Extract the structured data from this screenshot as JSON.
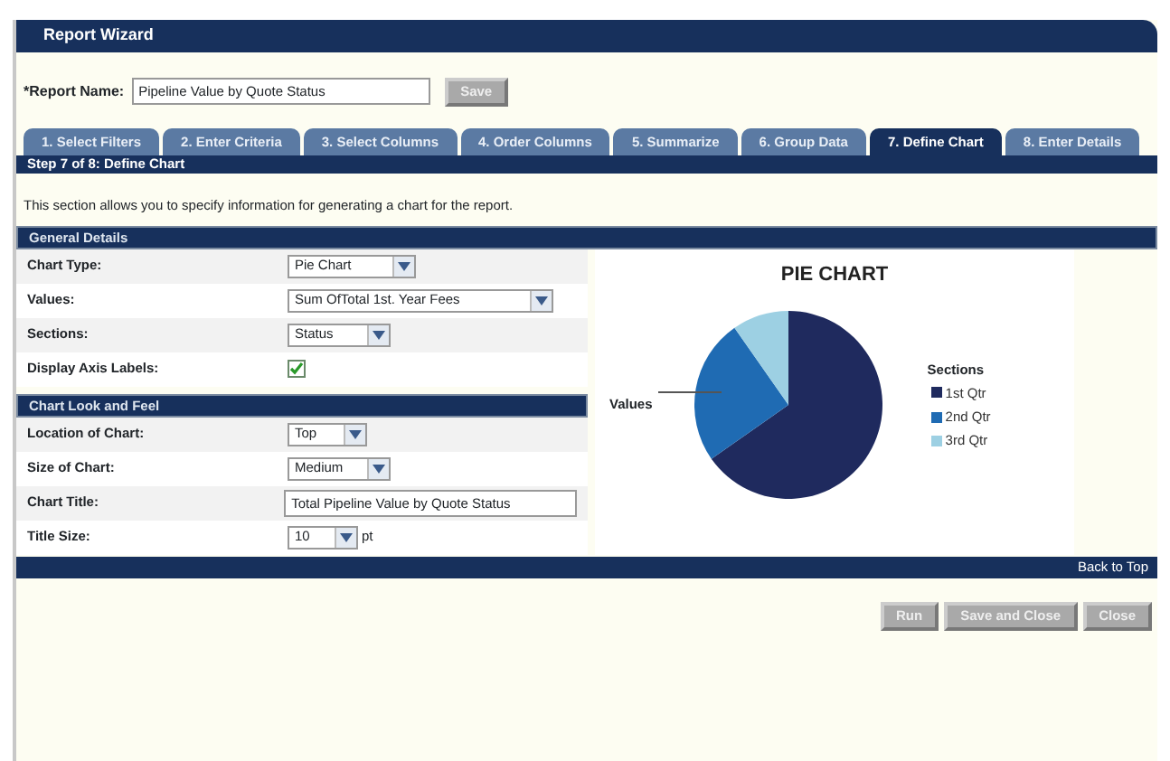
{
  "window": {
    "title": "Report Wizard"
  },
  "report_name": {
    "label": "*Report Name:",
    "value": "Pipeline Value by Quote Status"
  },
  "save_button": "Save",
  "tabs": [
    {
      "label": "1. Select Filters",
      "selected": false
    },
    {
      "label": "2. Enter Criteria",
      "selected": false
    },
    {
      "label": "3. Select Columns",
      "selected": false
    },
    {
      "label": "4. Order Columns",
      "selected": false
    },
    {
      "label": "5. Summarize",
      "selected": false
    },
    {
      "label": "6. Group Data",
      "selected": false
    },
    {
      "label": "7. Define Chart",
      "selected": true
    },
    {
      "label": "8. Enter Details",
      "selected": false
    }
  ],
  "step_title": "Step 7 of 8: Define Chart",
  "description": "This section allows you to specify information for generating a chart for the report.",
  "sections": [
    {
      "title": "General Details",
      "fields": [
        {
          "label": "Chart Type:",
          "kind": "select",
          "value": "Pie Chart"
        },
        {
          "label": "Values:",
          "kind": "select",
          "value": "Sum OfTotal 1st. Year Fees"
        },
        {
          "label": "Sections:",
          "kind": "select",
          "value": "Status"
        },
        {
          "label": "Display Axis Labels:",
          "kind": "checkbox",
          "checked": true
        }
      ]
    },
    {
      "title": "Chart Look and Feel",
      "fields": [
        {
          "label": "Location of Chart:",
          "kind": "select",
          "value": "Top"
        },
        {
          "label": "Size of Chart:",
          "kind": "select",
          "value": "Medium"
        },
        {
          "label": "Chart Title:",
          "kind": "text",
          "value": "Total Pipeline Value by Quote Status"
        },
        {
          "label": "Title Size:",
          "kind": "select",
          "value": "10",
          "suffix": "pt"
        }
      ]
    }
  ],
  "chart_preview": {
    "title": "PIE CHART",
    "values_label": "Values",
    "legend_title": "Sections",
    "legend": [
      {
        "label": "1st Qtr",
        "color": "#1f2a5e"
      },
      {
        "label": "2nd Qtr",
        "color": "#1f6bb3"
      },
      {
        "label": "3rd Qtr",
        "color": "#9dd0e3"
      }
    ]
  },
  "back_to_top": "Back to Top",
  "buttons": [
    "Run",
    "Save and Close",
    "Close"
  ]
}
